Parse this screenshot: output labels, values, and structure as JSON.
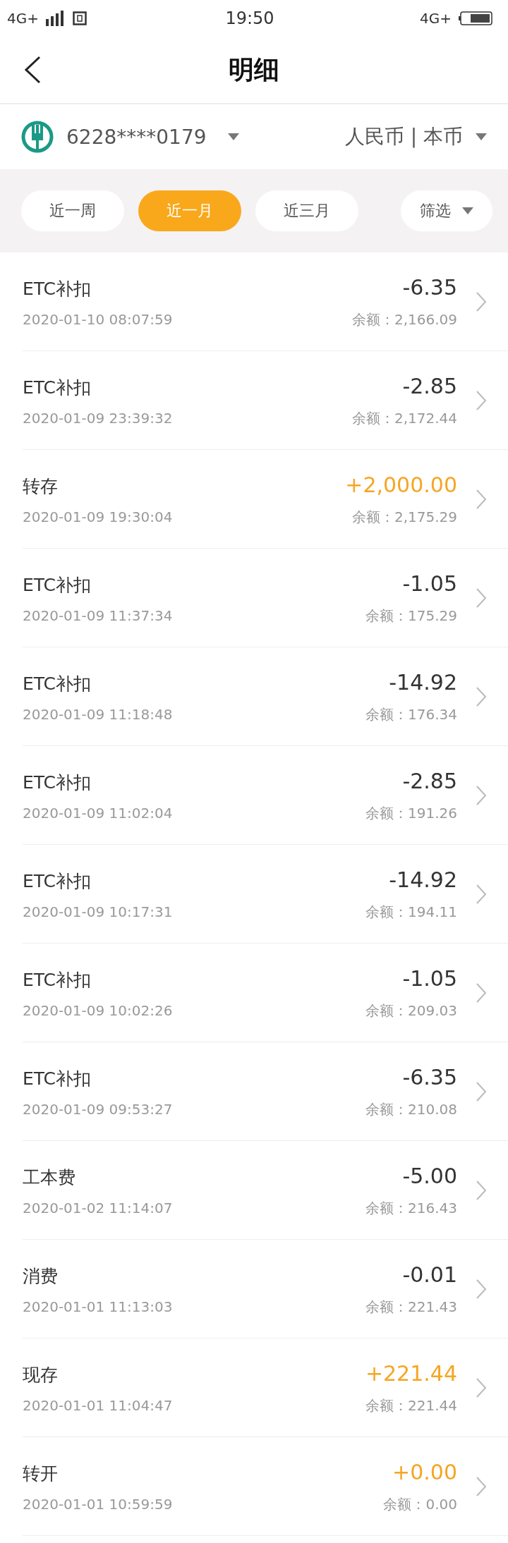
{
  "status_bar": {
    "network_left": "4G+",
    "time": "19:50",
    "network_right": "4G+"
  },
  "header": {
    "title": "明细"
  },
  "account": {
    "card_number": "6228****0179",
    "currency": "人民币 | 本币"
  },
  "period_tabs": [
    {
      "label": "近一周",
      "selected": false
    },
    {
      "label": "近一月",
      "selected": true
    },
    {
      "label": "近三月",
      "selected": false
    }
  ],
  "filter": {
    "label": "筛选"
  },
  "transactions": [
    {
      "name": "ETC补扣",
      "amount": "-6.35",
      "kind": "expense",
      "time": "2020-01-10 08:07:59",
      "balance": "余额：2,166.09"
    },
    {
      "name": "ETC补扣",
      "amount": "-2.85",
      "kind": "expense",
      "time": "2020-01-09 23:39:32",
      "balance": "余额：2,172.44"
    },
    {
      "name": "转存",
      "amount": "+2,000.00",
      "kind": "income",
      "time": "2020-01-09 19:30:04",
      "balance": "余额：2,175.29"
    },
    {
      "name": "ETC补扣",
      "amount": "-1.05",
      "kind": "expense",
      "time": "2020-01-09 11:37:34",
      "balance": "余额：175.29"
    },
    {
      "name": "ETC补扣",
      "amount": "-14.92",
      "kind": "expense",
      "time": "2020-01-09 11:18:48",
      "balance": "余额：176.34"
    },
    {
      "name": "ETC补扣",
      "amount": "-2.85",
      "kind": "expense",
      "time": "2020-01-09 11:02:04",
      "balance": "余额：191.26"
    },
    {
      "name": "ETC补扣",
      "amount": "-14.92",
      "kind": "expense",
      "time": "2020-01-09 10:17:31",
      "balance": "余额：194.11"
    },
    {
      "name": "ETC补扣",
      "amount": "-1.05",
      "kind": "expense",
      "time": "2020-01-09 10:02:26",
      "balance": "余额：209.03"
    },
    {
      "name": "ETC补扣",
      "amount": "-6.35",
      "kind": "expense",
      "time": "2020-01-09 09:53:27",
      "balance": "余额：210.08"
    },
    {
      "name": "工本费",
      "amount": "-5.00",
      "kind": "expense",
      "time": "2020-01-02 11:14:07",
      "balance": "余额：216.43"
    },
    {
      "name": "消费",
      "amount": "-0.01",
      "kind": "expense",
      "time": "2020-01-01 11:13:03",
      "balance": "余额：221.43"
    },
    {
      "name": "现存",
      "amount": "+221.44",
      "kind": "income",
      "time": "2020-01-01 11:04:47",
      "balance": "余额：221.44"
    },
    {
      "name": "转开",
      "amount": "+0.00",
      "kind": "income",
      "time": "2020-01-01 10:59:59",
      "balance": "余额：0.00"
    }
  ]
}
